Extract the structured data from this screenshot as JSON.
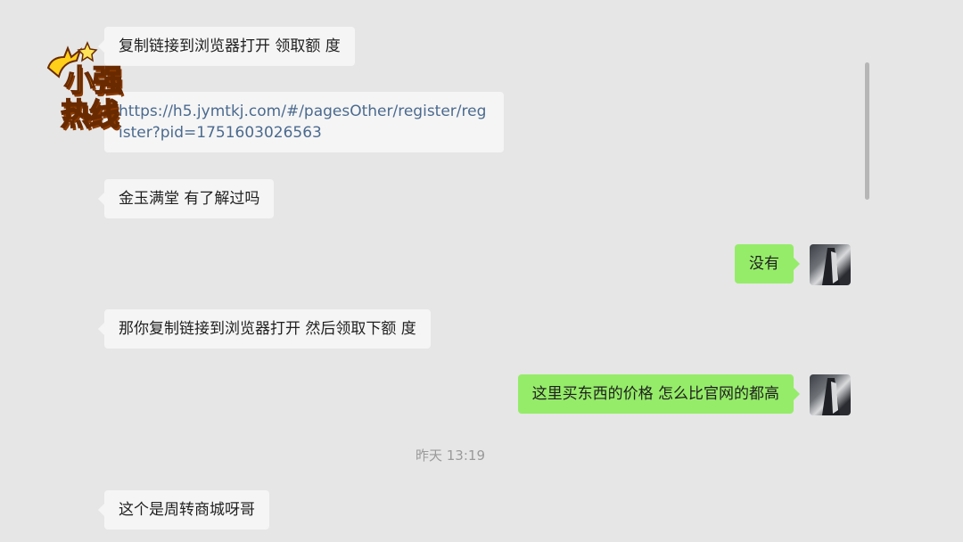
{
  "messages": [
    {
      "side": "left",
      "text": "复制链接到浏览器打开 领取额 度"
    },
    {
      "side": "left",
      "text": "https://h5.jymtkj.com/#/pagesOther/register/register?pid=1751603026563"
    },
    {
      "side": "left",
      "text": "金玉满堂 有了解过吗"
    },
    {
      "side": "right",
      "text": "没有"
    },
    {
      "side": "left",
      "text": "那你复制链接到浏览器打开 然后领取下额 度"
    },
    {
      "side": "right",
      "text": "这里买东西的价格 怎么比官网的都高"
    },
    {
      "side": "left",
      "text": "这个是周转商城呀哥"
    }
  ],
  "timestamp": "昨天 13:19",
  "watermark": {
    "line1": "小强",
    "line2": "热线"
  },
  "colors": {
    "incoming": "#f5f5f5",
    "outgoing": "#95ec69",
    "background": "#e6e6e6",
    "link": "#4b6a8f"
  },
  "icons": {
    "avatar": "user-avatar-icon",
    "logo": "xiaoqiang-hotline-logo-icon"
  }
}
